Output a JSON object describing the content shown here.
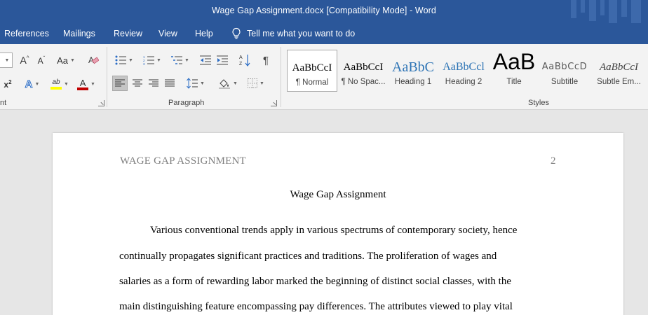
{
  "window": {
    "title": "Wage Gap Assignment.docx [Compatibility Mode]  -  Word"
  },
  "tabs": [
    {
      "label": "References"
    },
    {
      "label": "Mailings"
    },
    {
      "label": "Review"
    },
    {
      "label": "View"
    },
    {
      "label": "Help"
    }
  ],
  "tell_me": {
    "label": "Tell me what you want to do",
    "icon": "lightbulb-icon"
  },
  "ribbon": {
    "font_group_label": "nt",
    "font_buttons": [
      {
        "label": "A^",
        "icon": "grow-font-icon"
      },
      {
        "label": "A˅",
        "icon": "shrink-font-icon"
      },
      {
        "label": "Aa",
        "icon": "change-case-icon"
      },
      {
        "label": "",
        "icon": "clear-formatting-icon"
      },
      {
        "label": "x²",
        "icon": "superscript-icon"
      },
      {
        "label": "A",
        "icon": "text-effects-icon"
      },
      {
        "label": "ab",
        "icon": "highlight-icon"
      },
      {
        "label": "A",
        "icon": "font-color-icon"
      }
    ],
    "paragraph_group_label": "Paragraph",
    "paragraph_buttons": [
      {
        "icon": "bullets-icon"
      },
      {
        "icon": "numbering-icon"
      },
      {
        "icon": "multilevel-list-icon"
      },
      {
        "icon": "decrease-indent-icon"
      },
      {
        "icon": "increase-indent-icon"
      },
      {
        "icon": "sort-icon"
      },
      {
        "icon": "show-formatting-marks-icon"
      },
      {
        "icon": "align-left-icon"
      },
      {
        "icon": "align-center-icon"
      },
      {
        "icon": "align-right-icon"
      },
      {
        "icon": "justify-icon"
      },
      {
        "icon": "line-spacing-icon"
      },
      {
        "icon": "shading-icon"
      },
      {
        "icon": "borders-icon"
      }
    ],
    "styles_group_label": "Styles",
    "styles": [
      {
        "preview": "AaBbCcI",
        "name": "¶ Normal"
      },
      {
        "preview": "AaBbCcI",
        "name": "¶ No Spac..."
      },
      {
        "preview": "AaBbC",
        "name": "Heading 1"
      },
      {
        "preview": "AaBbCcl",
        "name": "Heading 2"
      },
      {
        "preview": "AaB",
        "name": "Title"
      },
      {
        "preview": "AaBbCcD",
        "name": "Subtitle"
      },
      {
        "preview": "AaBbCcI",
        "name": "Subtle Em..."
      }
    ],
    "colors": {
      "highlight": "#ffff00",
      "font_color": "#c00000",
      "heading_blue": "#2e74b5"
    }
  },
  "document": {
    "header_left": "WAGE GAP ASSIGNMENT",
    "page_number": "2",
    "title": "Wage Gap Assignment",
    "lines": [
      "Various conventional trends apply in various spectrums of contemporary society, hence",
      "continually propagates significant practices and traditions. The proliferation of wages and",
      "salaries as a form of rewarding labor marked the beginning of distinct social classes, with the",
      "main distinguishing feature encompassing pay differences. The attributes viewed to play vital"
    ]
  }
}
